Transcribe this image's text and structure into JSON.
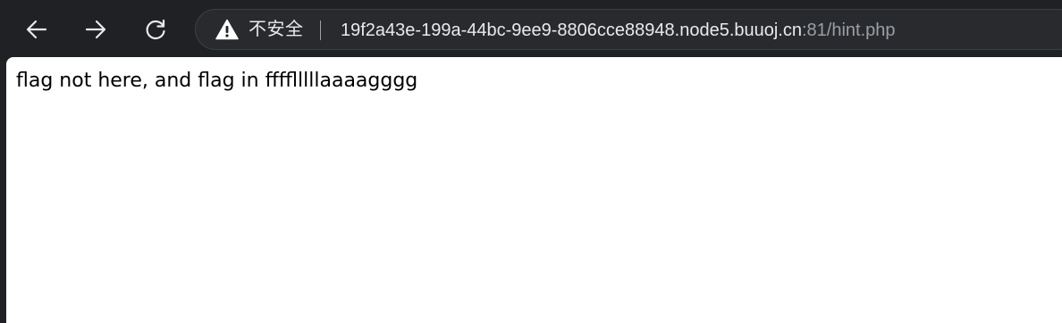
{
  "toolbar": {
    "back_icon": "arrow-left-icon",
    "forward_icon": "arrow-right-icon",
    "reload_icon": "reload-icon"
  },
  "omnibox": {
    "security_icon": "warning-triangle-icon",
    "security_label": "不安全",
    "url_host": "19f2a43e-199a-44bc-9ee9-8806cce88948.node5.buuoj.cn",
    "url_rest": ":81/hint.php"
  },
  "page": {
    "body_text": "flag not here, and flag in fffflllllaaaagggg"
  },
  "colors": {
    "chrome_bg": "#202124",
    "omnibox_bg": "#282a2d",
    "text_primary": "#e8eaed",
    "text_secondary": "#9aa0a6",
    "page_bg": "#ffffff"
  }
}
